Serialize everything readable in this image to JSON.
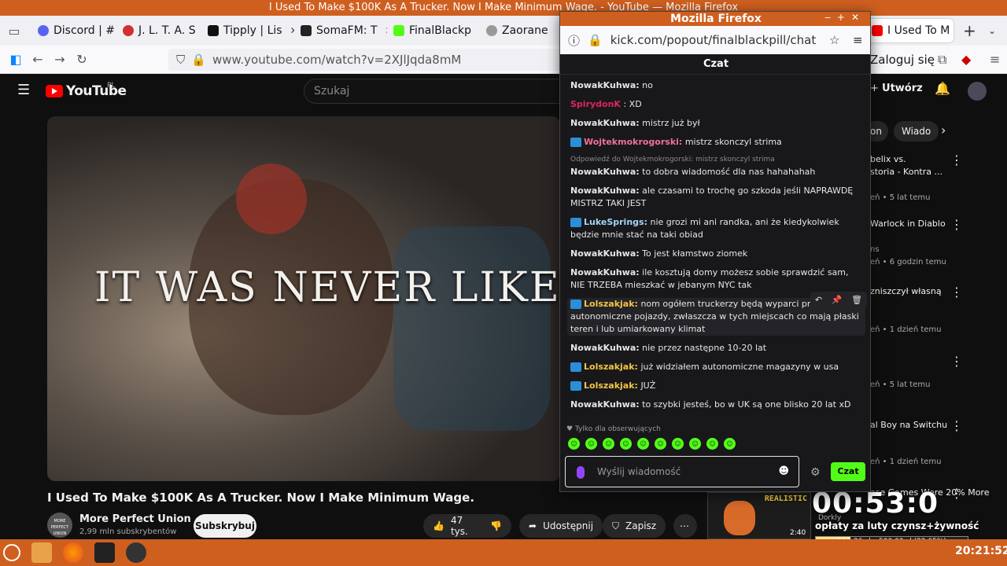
{
  "os": {
    "window_title": "I Used To Make $100K As A Trucker. Now I Make Minimum Wage. - YouTube — Mozilla Firefox"
  },
  "browser": {
    "tabs": [
      {
        "label": "Discord | #",
        "color": "#5865f2"
      },
      {
        "label": "J. L. T. A. S",
        "color": "#d32f2f"
      },
      {
        "label": "Tipply | Lis",
        "color": "#111111"
      },
      {
        "label": "SomaFM: T",
        "color": "#222222"
      },
      {
        "label": "FinalBlackp",
        "color": "#53fc18"
      },
      {
        "label": "Zaorane (",
        "color": "#999999"
      },
      {
        "label": "I Used To M",
        "color": "#ff0000"
      }
    ],
    "new_tab": "+",
    "url": "www.youtube.com/watch?v=2XJlJqda8mM",
    "login": "Zaloguj się"
  },
  "youtube": {
    "logo": "YouTube",
    "region": "PL",
    "search_placeholder": "Szukaj",
    "create_label": "Utwórz",
    "video_caption": "IT WAS NEVER LIKE T",
    "video_title": "I Used To Make $100K As A Trucker. Now I Make Minimum Wage.",
    "channel": {
      "name": "More Perfect Union",
      "subs": "2,99 mln subskrybentów",
      "avatar_text": "MORE PERFECT UNION"
    },
    "subscribe": "Subskrybuj",
    "likes": "47 tys.",
    "share": "Udostępnij",
    "save": "Zapisz",
    "chips": [
      "on",
      "Wiado"
    ],
    "sidebar": [
      {
        "title": "belix vs.",
        "line2": "storia - Kontra ...",
        "meta": "eń • 5 lat temu"
      },
      {
        "title": "Warlock in Diablo",
        "meta": "ns",
        "meta2": "eń • 6 godzin temu"
      },
      {
        "title": "zniszczył własną",
        "meta": "eń • 1 dzień temu"
      },
      {
        "title": "",
        "meta": "eń • 5 lat temu"
      },
      {
        "title": "al Boy na Switchu",
        "meta": "eń • 1 dzień temu"
      },
      {
        "title": "ase Games Were 20% More",
        "meta": ""
      }
    ]
  },
  "popup": {
    "title": "Mozilla Firefox",
    "url": "kick.com/popout/finalblackpill/chat",
    "chat_header": "Czat",
    "messages": [
      {
        "user": "NowakKuhwa:",
        "text": "no",
        "color": "#e6e6e6",
        "badge": false
      },
      {
        "user": "SpirydonK",
        "text": ": XD",
        "color": "#e0245e",
        "badge": false
      },
      {
        "user": "NowakKuhwa:",
        "text": "mistrz już był",
        "color": "#e6e6e6",
        "badge": false
      },
      {
        "user": "Wojtekmokrogorski:",
        "text": "mistrz skonczyl strima",
        "color": "#f0709a",
        "badge": true
      },
      {
        "reply": "Odpowiedź do Wojtekmokrogorski: mistrz skonczyl strima",
        "user": "NowakKuhwa:",
        "text": "to dobra wiadomość dla nas hahahahah",
        "color": "#e6e6e6",
        "badge": false
      },
      {
        "user": "NowakKuhwa:",
        "text": "ale czasami to trochę go szkoda jeśli NAPRAWDĘ MISTRZ TAKI JEST",
        "color": "#e6e6e6",
        "badge": false
      },
      {
        "user": "LukeSprings:",
        "text": "nie grozi mi ani randka, ani że kiedykolwiek będzie mnie stać na taki obiad",
        "color": "#a7d4f5",
        "badge": true
      },
      {
        "user": "NowakKuhwa:",
        "text": "To jest kłamstwo ziomek",
        "color": "#e6e6e6",
        "badge": false
      },
      {
        "user": "NowakKuhwa:",
        "text": "ile kosztują domy możesz sobie sprawdzić sam, NIE TRZEBA mieszkać w jebanym NYC tak",
        "color": "#e6e6e6",
        "badge": false
      },
      {
        "user": "Lolszakjak:",
        "text": "nom ogółem truckerzy będą wyparci przez autonomiczne pojazdy, zwłaszcza w tych miejscach co mają płaski teren i lub umiarkowany klimat",
        "color": "#f5c542",
        "badge": true,
        "hl": true
      },
      {
        "user": "NowakKuhwa:",
        "text": "nie przez następne 10-20 lat",
        "color": "#e6e6e6",
        "badge": false
      },
      {
        "user": "Lolszakjak:",
        "text": "już widziałem autonomiczne magazyny w usa",
        "color": "#f5c542",
        "badge": true
      },
      {
        "user": "Lolszakjak:",
        "text": "JUŻ",
        "color": "#f5c542",
        "badge": true
      },
      {
        "user": "NowakKuhwa:",
        "text": "to szybki jesteś, bo w UK są one blisko 20 lat xD",
        "color": "#e6e6e6",
        "badge": false
      }
    ],
    "followers_only": "Tylko dla obserwujących",
    "input_placeholder": "Wyślij wiadomość",
    "send": "Czat"
  },
  "overlay": {
    "cam_label": "REALISTIC",
    "timer": "00:53:0",
    "text": "opłaty za luty czynsz+żywność",
    "progress_label": "113,26 zł z 500,00 zł (22.65%)",
    "progress_fraction": 0.2265,
    "cam_name": "Dorkly",
    "cam_time": "2:40"
  },
  "taskbar": {
    "clock": "20:21:52"
  }
}
